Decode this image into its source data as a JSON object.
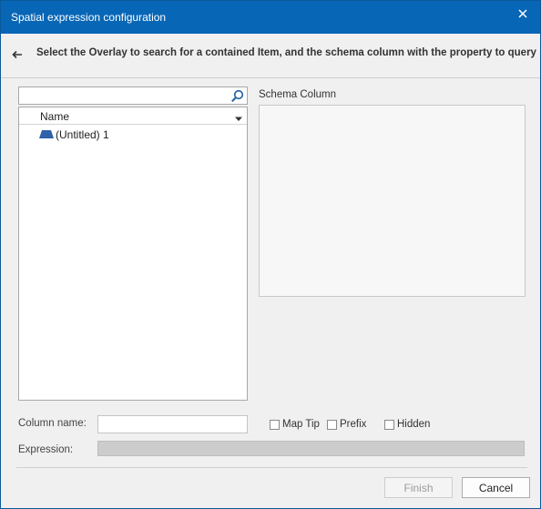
{
  "window": {
    "title": "Spatial expression configuration"
  },
  "header": {
    "instruction": "Select the Overlay to search for a contained Item, and the schema column with the property to query"
  },
  "search": {
    "value": "",
    "placeholder": ""
  },
  "tree": {
    "column_header": "Name",
    "items": [
      {
        "label": "(Untitled) 1",
        "icon": "overlay-icon"
      }
    ]
  },
  "schema": {
    "label": "Schema Column"
  },
  "column_name": {
    "label": "Column name:",
    "value": ""
  },
  "options": {
    "map_tip": "Map Tip",
    "prefix": "Prefix",
    "hidden": "Hidden"
  },
  "expression": {
    "label": "Expression:",
    "value": ""
  },
  "buttons": {
    "finish": "Finish",
    "cancel": "Cancel"
  },
  "colors": {
    "title_bar": "#0866b6",
    "overlay_icon": "#2f62a8"
  }
}
